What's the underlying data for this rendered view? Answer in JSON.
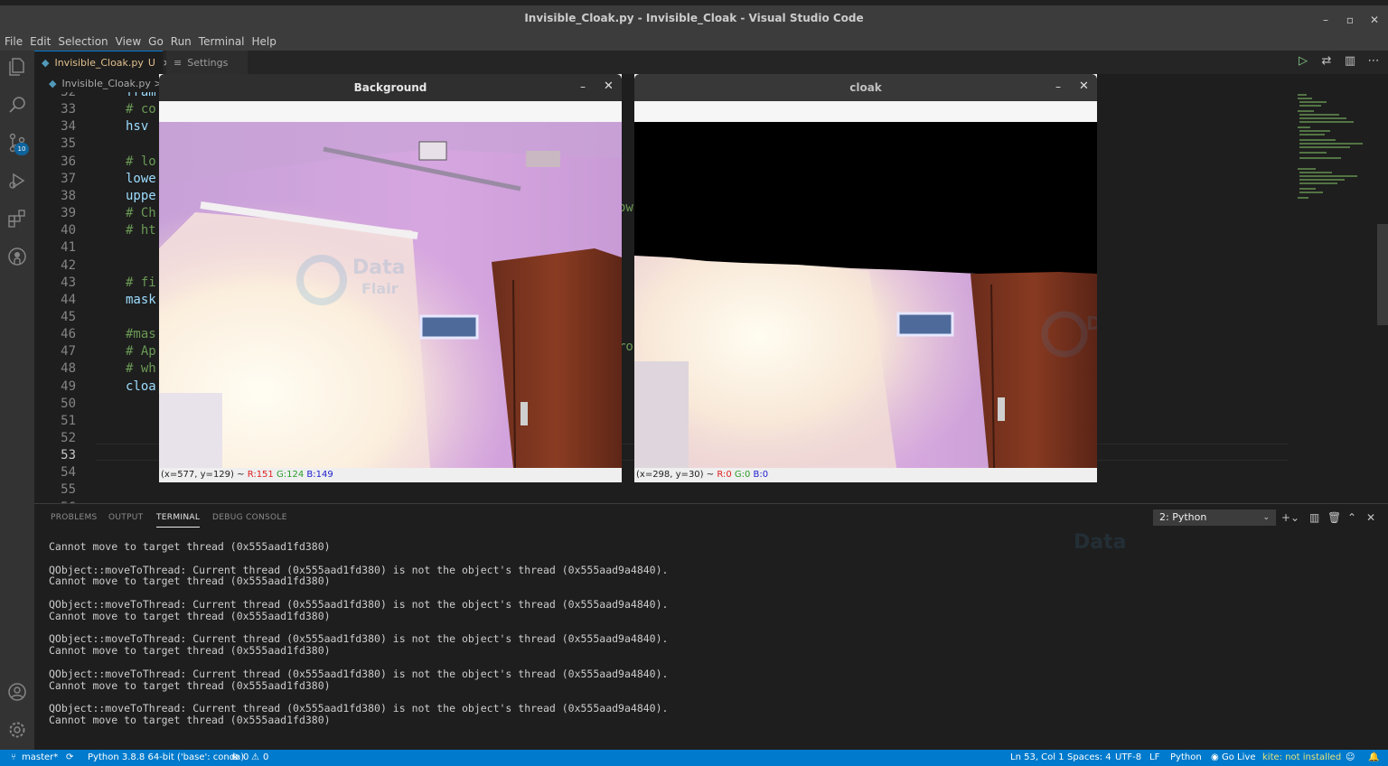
{
  "window": {
    "title": "Invisible_Cloak.py - Invisible_Cloak - Visual Studio Code"
  },
  "menu": [
    "File",
    "Edit",
    "Selection",
    "View",
    "Go",
    "Run",
    "Terminal",
    "Help"
  ],
  "activity": {
    "source_control_badge": "10"
  },
  "tabs": [
    {
      "label": "Invisible_Cloak.py",
      "status": "U",
      "close": "×"
    },
    {
      "label": "Settings"
    }
  ],
  "breadcrumb": "Invisible_Cloak.py > ...",
  "editor": {
    "lines": [
      {
        "n": "32",
        "text": "fram",
        "kind": "id"
      },
      {
        "n": "33",
        "text": "# co",
        "kind": "cm"
      },
      {
        "n": "34",
        "text": "hsv",
        "kind": "id"
      },
      {
        "n": "35",
        "text": "",
        "kind": "id"
      },
      {
        "n": "36",
        "text": "# lo",
        "kind": "cm"
      },
      {
        "n": "37",
        "text": "lowe",
        "kind": "id"
      },
      {
        "n": "38",
        "text": "uppe",
        "kind": "id"
      },
      {
        "n": "39",
        "text": "# Ch",
        "kind": "cm"
      },
      {
        "n": "40",
        "text": "# ht",
        "kind": "cm"
      },
      {
        "n": "41",
        "text": "",
        "kind": "id"
      },
      {
        "n": "42",
        "text": "",
        "kind": "id"
      },
      {
        "n": "43",
        "text": "# fi",
        "kind": "cm"
      },
      {
        "n": "44",
        "text": "mask",
        "kind": "id"
      },
      {
        "n": "45",
        "text": "",
        "kind": "id"
      },
      {
        "n": "46",
        "text": "#mas",
        "kind": "cm"
      },
      {
        "n": "47",
        "text": "# Ap",
        "kind": "cm"
      },
      {
        "n": "48",
        "text": "# wh",
        "kind": "cm"
      },
      {
        "n": "49",
        "text": "cloa",
        "kind": "id"
      },
      {
        "n": "50",
        "text": "",
        "kind": "id"
      },
      {
        "n": "51",
        "text": "",
        "kind": "id"
      },
      {
        "n": "52",
        "text": "",
        "kind": "id"
      },
      {
        "n": "53",
        "text": "",
        "kind": "id"
      },
      {
        "n": "54",
        "text": "",
        "kind": "id"
      },
      {
        "n": "55",
        "text": "",
        "kind": "id"
      },
      {
        "n": "56",
        "text": "",
        "kind": "id"
      }
    ],
    "current_line": "53",
    "fragment_39": "ow",
    "fragment_47": "ro"
  },
  "panel": {
    "tabs": [
      "PROBLEMS",
      "OUTPUT",
      "TERMINAL",
      "DEBUG CONSOLE"
    ],
    "active_tab": "TERMINAL",
    "terminal_select": "2: Python",
    "terminal_lines": [
      "Cannot move to target thread (0x555aad1fd380)",
      "",
      "QObject::moveToThread: Current thread (0x555aad1fd380) is not the object's thread (0x555aad9a4840).",
      "Cannot move to target thread (0x555aad1fd380)",
      "",
      "QObject::moveToThread: Current thread (0x555aad1fd380) is not the object's thread (0x555aad9a4840).",
      "Cannot move to target thread (0x555aad1fd380)",
      "",
      "QObject::moveToThread: Current thread (0x555aad1fd380) is not the object's thread (0x555aad9a4840).",
      "Cannot move to target thread (0x555aad1fd380)",
      "",
      "QObject::moveToThread: Current thread (0x555aad1fd380) is not the object's thread (0x555aad9a4840).",
      "Cannot move to target thread (0x555aad1fd380)",
      "",
      "QObject::moveToThread: Current thread (0x555aad1fd380) is not the object's thread (0x555aad9a4840).",
      "Cannot move to target thread (0x555aad1fd380)"
    ]
  },
  "statusbar": {
    "branch": "master*",
    "interpreter": "Python 3.8.8 64-bit ('base': conda)",
    "errors": "0",
    "warnings": "0",
    "position": "Ln 53, Col 1",
    "spaces": "Spaces: 4",
    "encoding": "UTF-8",
    "eol": "LF",
    "language": "Python",
    "go_live": "Go Live",
    "kite": "kite: not installed"
  },
  "cv_windows": [
    {
      "title": "Background",
      "coords": "(x=577, y=129) ~",
      "r": "R:151",
      "g": "G:124",
      "b": "B:149"
    },
    {
      "title": "cloak",
      "coords": "(x=298, y=30) ~",
      "r": "R:0",
      "g": "G:0",
      "b": "B:0"
    }
  ],
  "watermark": {
    "line1": "Data",
    "line2": "Flair"
  },
  "colors": {
    "accent": "#007acc",
    "comment": "#6a9955",
    "identifier": "#9cdcfe",
    "untracked": "#e2c08d"
  }
}
